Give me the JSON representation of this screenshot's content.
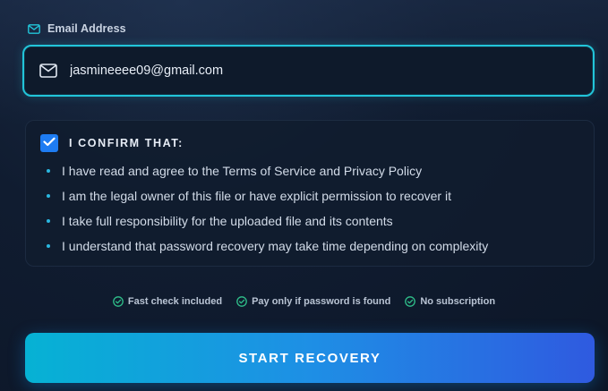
{
  "email": {
    "label": "Email Address",
    "label_icon": "mail-icon",
    "value": "jasmineeee09@gmail.com",
    "field_icon": "mail-icon"
  },
  "confirm": {
    "checked": true,
    "title": "I CONFIRM THAT:",
    "items": [
      "I have read and agree to the Terms of Service and Privacy Policy",
      "I am the legal owner of this file or have explicit permission to recover it",
      "I take full responsibility for the uploaded file and its contents",
      "I understand that password recovery may take time depending on complexity"
    ]
  },
  "features": [
    {
      "icon": "check-circle-icon",
      "label": "Fast check included"
    },
    {
      "icon": "check-circle-icon",
      "label": "Pay only if password is found"
    },
    {
      "icon": "check-circle-icon",
      "label": "No subscription"
    }
  ],
  "cta": {
    "label": "START RECOVERY"
  },
  "colors": {
    "accent_cyan": "#22c5d9",
    "checkbox_blue": "#1e7cf2",
    "success_green": "#2fbf8a",
    "button_gradient_start": "#06b2d4",
    "button_gradient_end": "#2f5ae0"
  }
}
